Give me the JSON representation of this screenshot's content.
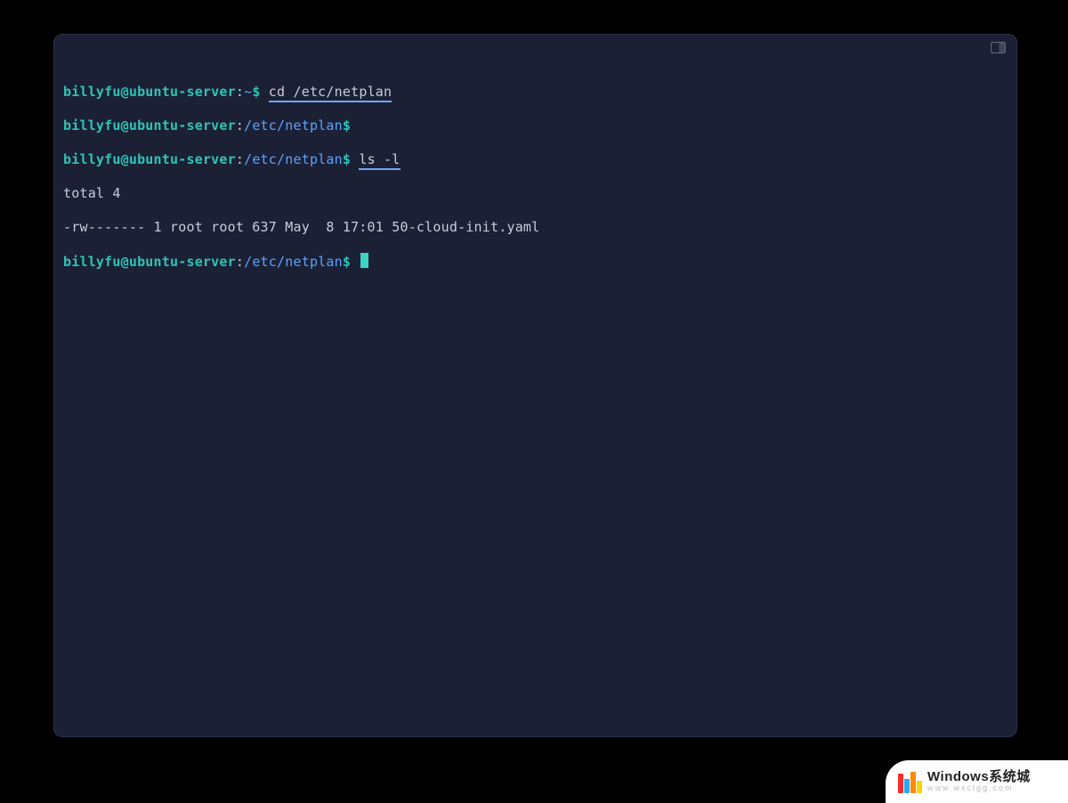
{
  "colors": {
    "bg": "#000000",
    "term_bg": "#1b2034",
    "user_fg": "#2ec4b6",
    "path_fg": "#5aa2ff",
    "text_fg": "#c9cdd9",
    "underline": "#6fa8ff",
    "cursor": "#3bd4c5"
  },
  "lines": [
    {
      "user": "billyfu@ubuntu-server",
      "sep": ":",
      "dir": "~",
      "dollar": "$",
      "cmd": "cd /etc/netplan",
      "cmd_underlined": true
    },
    {
      "user": "billyfu@ubuntu-server",
      "sep": ":",
      "dir": "/etc/netplan",
      "dollar": "$",
      "cmd": ""
    },
    {
      "user": "billyfu@ubuntu-server",
      "sep": ":",
      "dir": "/etc/netplan",
      "dollar": "$",
      "cmd": "ls -l",
      "cmd_underlined": true
    }
  ],
  "output": [
    "total 4",
    "-rw------- 1 root root 637 May  8 17:01 50-cloud-init.yaml"
  ],
  "prompt_after": {
    "user": "billyfu@ubuntu-server",
    "sep": ":",
    "dir": "/etc/netplan",
    "dollar": "$"
  },
  "watermark": {
    "title": "Windows系统城",
    "subtitle": "www.wxclgg.com",
    "bars": [
      {
        "color": "#ff2a2a",
        "h": 22
      },
      {
        "color": "#2aa8ff",
        "h": 16
      },
      {
        "color": "#ff8a00",
        "h": 24
      },
      {
        "color": "#ffd400",
        "h": 14
      }
    ]
  }
}
